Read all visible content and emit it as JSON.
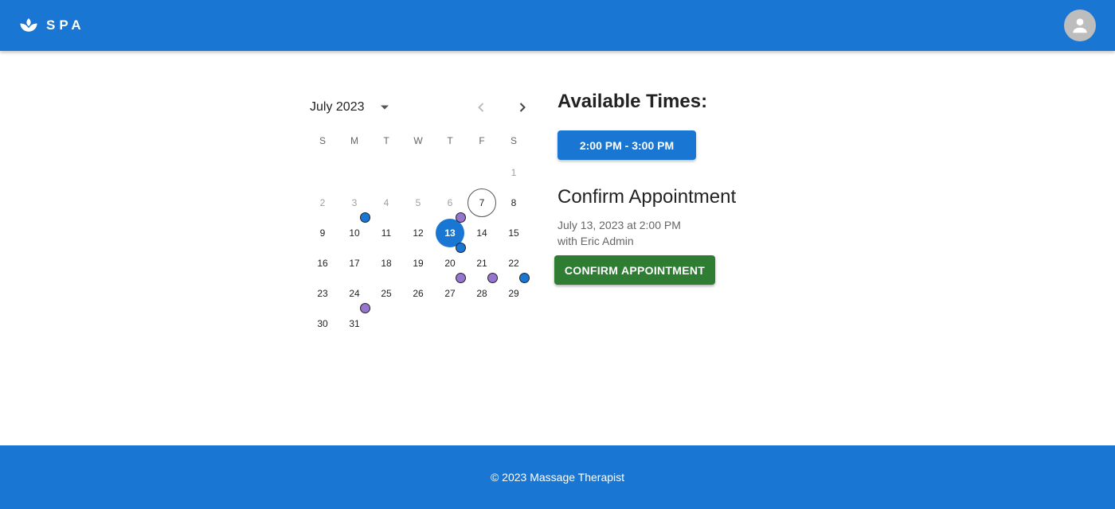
{
  "header": {
    "logo_text": "SPA",
    "logo_icon": "lotus-icon",
    "avatar_icon": "person-icon"
  },
  "calendar": {
    "month_label": "July 2023",
    "weekdays": [
      "S",
      "M",
      "T",
      "W",
      "T",
      "F",
      "S"
    ],
    "first_weekday_index": 6,
    "days_in_month": 31,
    "disabled_until": 6,
    "today": 7,
    "selected": 13,
    "markers": [
      {
        "day": 10,
        "color": "blue"
      },
      {
        "day": 13,
        "color": "purple"
      },
      {
        "day": 20,
        "color": "blue"
      },
      {
        "day": 27,
        "color": "purple"
      },
      {
        "day": 28,
        "color": "purple"
      },
      {
        "day": 29,
        "color": "blue"
      },
      {
        "day": 31,
        "color": "purple"
      }
    ]
  },
  "colors": {
    "primary": "#1976d2",
    "success": "#2e7d32",
    "blue": "#1976d2",
    "purple": "#9575cd"
  },
  "available": {
    "heading": "Available Times:",
    "slots": [
      "2:00 PM - 3:00 PM"
    ]
  },
  "confirm": {
    "heading": "Confirm Appointment",
    "date_line": "July 13, 2023 at 2:00 PM",
    "with_line": "with Eric Admin",
    "button_label": "CONFIRM APPOINTMENT"
  },
  "footer": {
    "text": "© 2023 Massage Therapist"
  }
}
